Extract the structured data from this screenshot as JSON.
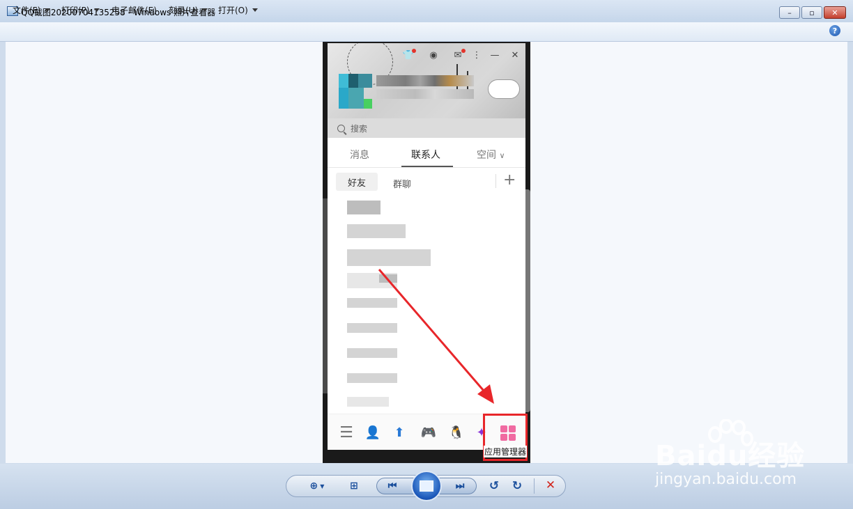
{
  "window": {
    "title": "QQ截图20200704135258 - Windows 照片查看器",
    "minimize": "–",
    "maximize": "▫",
    "close": "✕"
  },
  "menu": {
    "file": "文件(F)",
    "print": "打印(P)",
    "email": "电子邮件(E)",
    "burn": "刻录(U)",
    "open": "打开(O)",
    "help": "?"
  },
  "qq": {
    "search_placeholder": "搜索",
    "tabs": [
      "消息",
      "联系人",
      "空间"
    ],
    "tab_space_chevron": "∨",
    "sub_tabs": [
      "好友",
      "群聊"
    ],
    "add": "+",
    "app_manager_label": "应用管理器"
  },
  "toolbar": {
    "zoom": "⊕",
    "fit": "⊞",
    "prev": "⏮",
    "next": "⏭",
    "rotate_ccw": "↺",
    "rotate_cw": "↻",
    "delete": "✕"
  },
  "watermark": {
    "logo": "Baidu经验",
    "url": "jingyan.baidu.com"
  },
  "colors": {
    "highlight": "#e8262a",
    "arrow": "#e8262a",
    "app_manager": "#f06aa1"
  }
}
